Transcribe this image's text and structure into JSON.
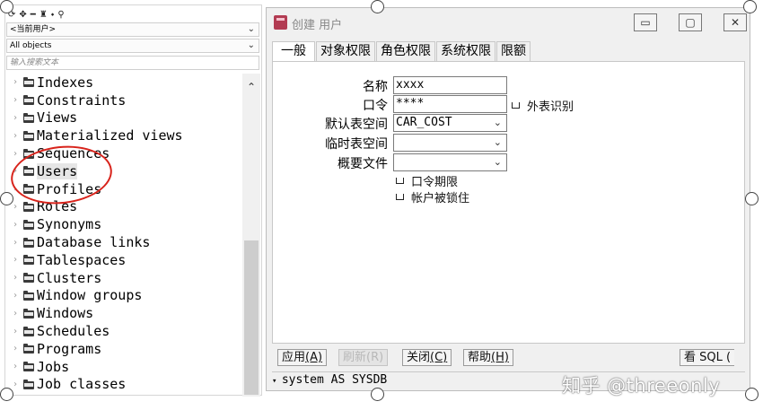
{
  "browser": {
    "toolbar_icons": [
      "refresh-icon",
      "add-icon",
      "remove-icon",
      "find-icon",
      "filter-icon",
      "properties-icon"
    ],
    "user_combo": "<当前用户>",
    "objects_combo": "All objects",
    "filter_placeholder": "输入搜索文本",
    "tree_items": [
      "Indexes",
      "Constraints",
      "Views",
      "Materialized views",
      "Sequences",
      "Users",
      "Profiles",
      "Roles",
      "Synonyms",
      "Database links",
      "Tablespaces",
      "Clusters",
      "Window groups",
      "Windows",
      "Schedules",
      "Programs",
      "Jobs",
      "Job classes"
    ],
    "selected_item": "Users",
    "annotation_color": "#d8231b"
  },
  "dialog": {
    "title": "创建 用户",
    "tabs": [
      "一般",
      "对象权限",
      "角色权限",
      "系统权限",
      "限额"
    ],
    "active_tab": "一般",
    "form": {
      "name_label": "名称",
      "name_value": "xxxx",
      "password_label": "口令",
      "password_value": "****",
      "external_label": "外表识别",
      "default_ts_label": "默认表空间",
      "default_ts_value": "CAR_COST",
      "temp_ts_label": "临时表空间",
      "temp_ts_value": "",
      "profile_label": "概要文件",
      "profile_value": "",
      "pwd_expired_label": "口令期限",
      "locked_label": "帐户被锁住"
    },
    "buttons": {
      "apply": "应用",
      "apply_key": "(A)",
      "refresh": "刷新(R)",
      "close": "关闭",
      "close_key": "(C)",
      "help": "帮助",
      "help_key": "(H)",
      "view_sql": "看 SQL ("
    },
    "connection": "system AS SYSDB"
  },
  "watermark": "知乎 @threeonly"
}
